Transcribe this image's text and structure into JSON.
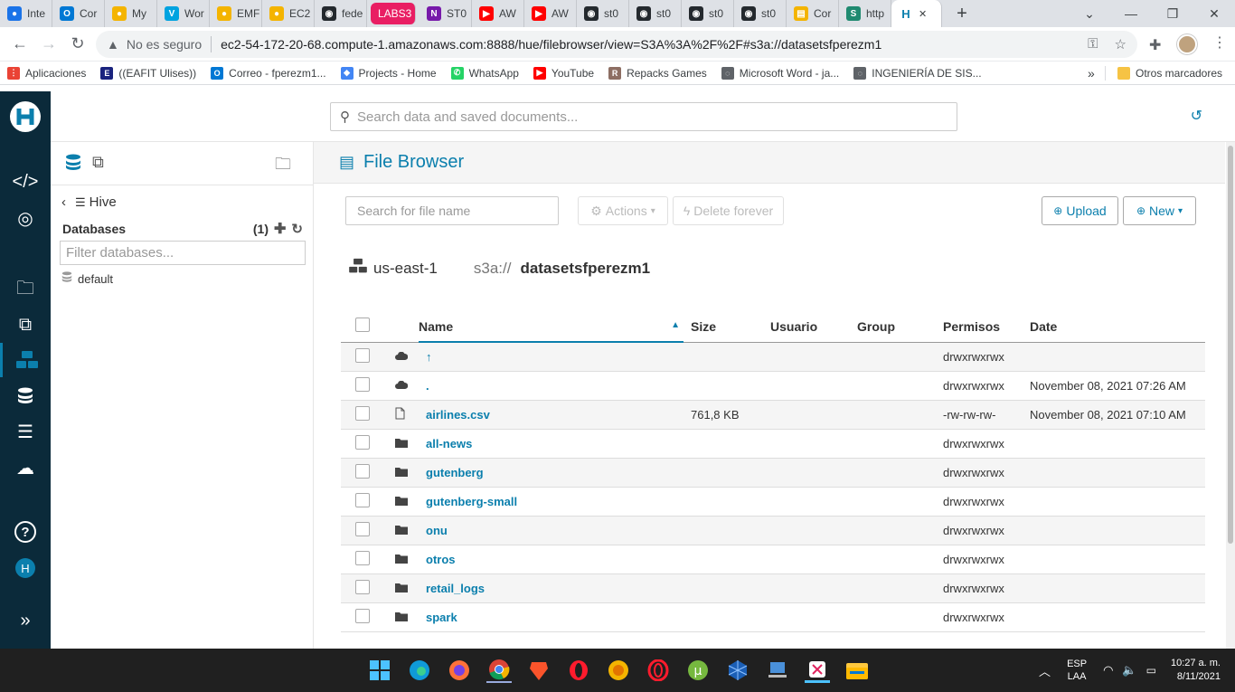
{
  "browser": {
    "tabs": [
      {
        "label": "Inte",
        "color": "#1a73e8",
        "glyph": "●"
      },
      {
        "label": "Cor",
        "color": "#0078d4",
        "glyph": "O"
      },
      {
        "label": "My",
        "color": "#f4b400",
        "glyph": "●"
      },
      {
        "label": "Wor",
        "color": "#00a3e0",
        "glyph": "V"
      },
      {
        "label": "EMF",
        "color": "#f4b400",
        "glyph": "●"
      },
      {
        "label": "EC2",
        "color": "#f4b400",
        "glyph": "●"
      },
      {
        "label": "fede",
        "color": "#24292e",
        "glyph": "◉"
      },
      {
        "label": "LABS3",
        "color": "#e91e63",
        "glyph": ""
      },
      {
        "label": "ST0",
        "color": "#7719aa",
        "glyph": "N"
      },
      {
        "label": "AW",
        "color": "#ff0000",
        "glyph": "▶"
      },
      {
        "label": "AW",
        "color": "#ff0000",
        "glyph": "▶"
      },
      {
        "label": "st0",
        "color": "#24292e",
        "glyph": "◉"
      },
      {
        "label": "st0",
        "color": "#24292e",
        "glyph": "◉"
      },
      {
        "label": "st0",
        "color": "#24292e",
        "glyph": "◉"
      },
      {
        "label": "st0",
        "color": "#24292e",
        "glyph": "◉"
      },
      {
        "label": "Cor",
        "color": "#f4b400",
        "glyph": "▤"
      },
      {
        "label": "http",
        "color": "#1f8a70",
        "glyph": "S"
      }
    ],
    "active_tab_close": "✕",
    "new_tab": "+",
    "nav": {
      "back": "←",
      "forward": "→",
      "reload": "↻"
    },
    "security_warning": "No es seguro",
    "url": "ec2-54-172-20-68.compute-1.amazonaws.com:8888/hue/filebrowser/view=S3A%3A%2F%2F#s3a://datasetsfperezm1",
    "bookmarks": [
      {
        "label": "Aplicaciones",
        "color": "#ea4335",
        "glyph": "⋮"
      },
      {
        "label": "((EAFIT Ulises))",
        "color": "#1a237e",
        "glyph": "E"
      },
      {
        "label": "Correo - fperezm1...",
        "color": "#0078d4",
        "glyph": "O"
      },
      {
        "label": "Projects - Home",
        "color": "#4285f4",
        "glyph": "◆"
      },
      {
        "label": "WhatsApp",
        "color": "#25d366",
        "glyph": "✆"
      },
      {
        "label": "YouTube",
        "color": "#ff0000",
        "glyph": "▶"
      },
      {
        "label": "Repacks Games",
        "color": "#8d6e63",
        "glyph": "R"
      },
      {
        "label": "Microsoft Word - ja...",
        "color": "#5f6368",
        "glyph": "◌"
      },
      {
        "label": "INGENIERÍA DE SIS...",
        "color": "#5f6368",
        "glyph": "◌"
      }
    ],
    "bookmarks_more": "»",
    "other_bookmarks": "Otros marcadores"
  },
  "hue": {
    "search_placeholder": "Search data and saved documents...",
    "assist": {
      "hive_label": "Hive",
      "databases_label": "Databases",
      "databases_count": "(1)",
      "filter_placeholder": "Filter databases...",
      "databases": [
        "default"
      ]
    },
    "page_title": "File Browser",
    "toolbar": {
      "search_placeholder": "Search for file name",
      "actions": "Actions",
      "delete_forever": "Delete forever",
      "upload": "Upload",
      "new": "New"
    },
    "breadcrumb": {
      "region": "us-east-1",
      "scheme": "s3a://",
      "bucket": "datasetsfperezm1"
    },
    "columns": [
      "Name",
      "Size",
      "Usuario",
      "Group",
      "Permisos",
      "Date"
    ],
    "rows": [
      {
        "type": "up",
        "name": "↑",
        "size": "",
        "user": "",
        "group": "",
        "perms": "drwxrwxrwx",
        "date": ""
      },
      {
        "type": "cloud",
        "name": ".",
        "size": "",
        "user": "",
        "group": "",
        "perms": "drwxrwxrwx",
        "date": "November 08, 2021 07:26 AM"
      },
      {
        "type": "file",
        "name": "airlines.csv",
        "size": "761,8 KB",
        "user": "",
        "group": "",
        "perms": "-rw-rw-rw-",
        "date": "November 08, 2021 07:10 AM"
      },
      {
        "type": "folder",
        "name": "all-news",
        "size": "",
        "user": "",
        "group": "",
        "perms": "drwxrwxrwx",
        "date": ""
      },
      {
        "type": "folder",
        "name": "gutenberg",
        "size": "",
        "user": "",
        "group": "",
        "perms": "drwxrwxrwx",
        "date": ""
      },
      {
        "type": "folder",
        "name": "gutenberg-small",
        "size": "",
        "user": "",
        "group": "",
        "perms": "drwxrwxrwx",
        "date": ""
      },
      {
        "type": "folder",
        "name": "onu",
        "size": "",
        "user": "",
        "group": "",
        "perms": "drwxrwxrwx",
        "date": ""
      },
      {
        "type": "folder",
        "name": "otros",
        "size": "",
        "user": "",
        "group": "",
        "perms": "drwxrwxrwx",
        "date": ""
      },
      {
        "type": "folder",
        "name": "retail_logs",
        "size": "",
        "user": "",
        "group": "",
        "perms": "drwxrwxrwx",
        "date": ""
      },
      {
        "type": "folder",
        "name": "spark",
        "size": "",
        "user": "",
        "group": "",
        "perms": "drwxrwxrwx",
        "date": ""
      }
    ],
    "accent": "#0b7fad",
    "sidebar_bg": "#0b2a3a",
    "user_initial": "H"
  },
  "taskbar": {
    "language": "ESP",
    "layout": "LAA",
    "time": "10:27 a. m.",
    "date": "8/11/2021"
  }
}
